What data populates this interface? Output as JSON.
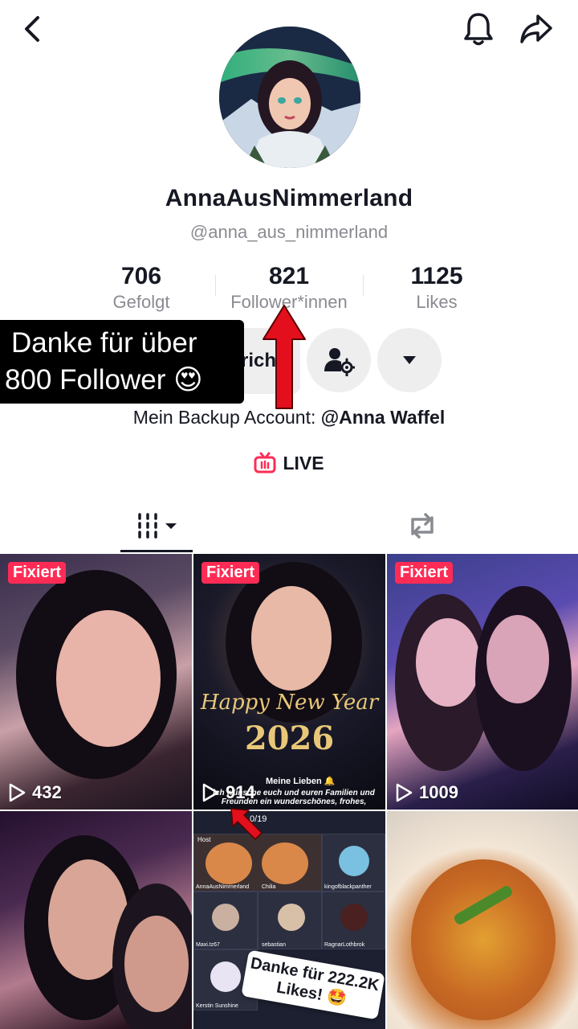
{
  "header": {
    "back_icon": "chevron-left-icon",
    "bell_icon": "bell-icon",
    "share_icon": "share-arrow-icon"
  },
  "profile": {
    "display_name": "AnnaAusNimmerland",
    "handle": "@anna_aus_nimmerland",
    "stats": {
      "following": {
        "value": "706",
        "label": "Gefolgt"
      },
      "followers": {
        "value": "821",
        "label": "Follower*innen"
      },
      "likes": {
        "value": "1125",
        "label": "Likes"
      }
    },
    "message_button_fragment": "richt",
    "bio_prefix": "Mein Backup Account: ",
    "bio_mention": "@Anna Waffel",
    "live_label": "LIVE"
  },
  "overlay": {
    "caption_line1": "Danke für über",
    "caption_line2": "800 Follower 😍"
  },
  "grid": {
    "tiles": [
      {
        "pinned_label": "Fixiert",
        "views": "432"
      },
      {
        "pinned_label": "Fixiert",
        "views": "914",
        "text_top": "Happy New Year",
        "text_year": "2026",
        "caption_title": "Meine Lieben 🔔",
        "caption_body": "ich wünsche euch und euren Familien und Freunden ein wunderschönes, frohes,"
      },
      {
        "pinned_label": "Fixiert",
        "views": "1009"
      },
      {},
      {
        "live_counter": "0/19",
        "host_label": "Host",
        "host_name": "AnnaAusNimmerland",
        "user2": "Chilia",
        "user3": "kingofblackpanther",
        "user4": "Maxi.tz67",
        "user5": "sebastian",
        "user6": "RagnarLothbrok",
        "user7": "Kerstin Sunshine",
        "sticker_text": "Danke für 222.2K Likes! 🤩"
      },
      {}
    ]
  },
  "colors": {
    "accent_red": "#fe2c55",
    "text_primary": "#161823",
    "text_secondary": "#8a8b91"
  }
}
